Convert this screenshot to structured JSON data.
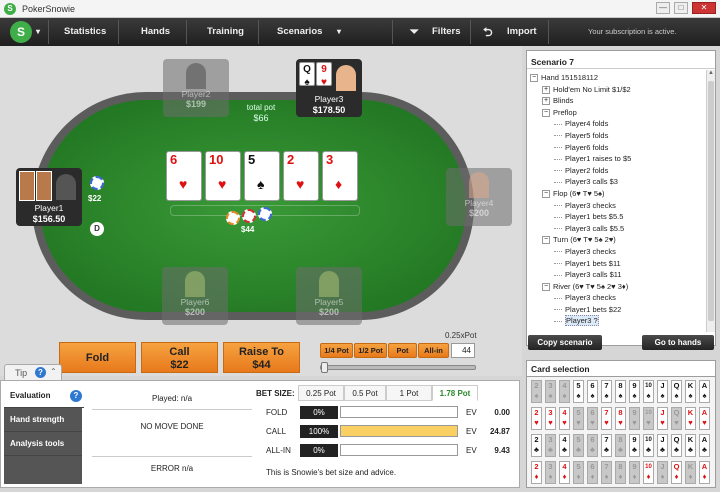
{
  "app": {
    "title": "PokerSnowie"
  },
  "window": {
    "minimize": "—",
    "maximize": "□",
    "close": "✕"
  },
  "menu": {
    "logo": "S",
    "items": [
      "Statistics",
      "Hands",
      "Training",
      "Scenarios"
    ],
    "filters": "Filters",
    "import": "Import",
    "subscription": "Your subscription is active."
  },
  "table": {
    "total_pot_label": "total pot",
    "total_pot": "$66",
    "bet_amount": "$22",
    "pot_chips_amount": "$44",
    "dealer": "D",
    "board": [
      {
        "rank": "6",
        "suit": "♥",
        "color": "red"
      },
      {
        "rank": "10",
        "suit": "♥",
        "color": "red"
      },
      {
        "rank": "5",
        "suit": "♠",
        "color": "black"
      },
      {
        "rank": "2",
        "suit": "♥",
        "color": "red"
      },
      {
        "rank": "3",
        "suit": "♦",
        "color": "red"
      }
    ],
    "hero_cards": [
      {
        "rank": "Q",
        "suit": "♠",
        "color": "black"
      },
      {
        "rank": "9",
        "suit": "♥",
        "color": "red"
      }
    ],
    "seats": [
      {
        "name": "Player2",
        "stack": "$199"
      },
      {
        "name": "Player3",
        "stack": "$178.50"
      },
      {
        "name": "Player1",
        "stack": "$156.50"
      },
      {
        "name": "Player4",
        "stack": "$200"
      },
      {
        "name": "Player6",
        "stack": "$200"
      },
      {
        "name": "Player5",
        "stack": "$200"
      }
    ]
  },
  "actions": {
    "fold": "Fold",
    "call": "Call",
    "call_amount": "$22",
    "raise": "Raise To",
    "raise_amount": "$44",
    "pot_buttons": [
      "1/4 Pot",
      "1/2 Pot",
      "Pot",
      "All-in"
    ],
    "bet_input": "44",
    "slider_label": "0.25xPot"
  },
  "tip": {
    "label": "Tip",
    "icon": "?"
  },
  "left_nav": [
    "Evaluation",
    "Hand strength",
    "Analysis tools"
  ],
  "evaluation": {
    "played": "Played: n/a",
    "no_move": "NO MOVE DONE",
    "error": "ERROR n/a",
    "bet_size_label": "BET SIZE:",
    "bet_sizes": [
      "0.25 Pot",
      "0.5 Pot",
      "1 Pot",
      "1.78 Pot"
    ],
    "rows": [
      {
        "action": "FOLD",
        "pct_text": "0%",
        "pct": 0,
        "ev_label": "EV",
        "ev": "0.00"
      },
      {
        "action": "CALL",
        "pct_text": "100%",
        "pct": 100,
        "ev_label": "EV",
        "ev": "24.87"
      },
      {
        "action": "ALL-IN",
        "pct_text": "0%",
        "pct": 0,
        "ev_label": "EV",
        "ev": "9.43"
      }
    ],
    "advice": "This is Snowie's bet size and advice."
  },
  "scenario": {
    "title": "Scenario 7",
    "tree": [
      {
        "text": "Hand 151518112",
        "level": 0,
        "toggle": "−"
      },
      {
        "text": "Hold'em No Limit $1/$2",
        "level": 1,
        "toggle": "+"
      },
      {
        "text": "Blinds",
        "level": 1,
        "toggle": "+"
      },
      {
        "text": "Preflop",
        "level": 1,
        "toggle": "−"
      },
      {
        "text": "Player4 folds",
        "level": 2
      },
      {
        "text": "Player5 folds",
        "level": 2
      },
      {
        "text": "Player6 folds",
        "level": 2
      },
      {
        "text": "Player1 raises to $5",
        "level": 2
      },
      {
        "text": "Player2 folds",
        "level": 2
      },
      {
        "text": "Player3 calls $3",
        "level": 2
      },
      {
        "text": "Flop (6♥ T♥ 5♠)",
        "level": 1,
        "toggle": "−"
      },
      {
        "text": "Player3 checks",
        "level": 2
      },
      {
        "text": "Player1 bets $5.5",
        "level": 2
      },
      {
        "text": "Player3 calls $5.5",
        "level": 2
      },
      {
        "text": "Turn (6♥ T♥ 5♠ 2♥)",
        "level": 1,
        "toggle": "−"
      },
      {
        "text": "Player3 checks",
        "level": 2
      },
      {
        "text": "Player1 bets $11",
        "level": 2
      },
      {
        "text": "Player3 calls $11",
        "level": 2
      },
      {
        "text": "River (6♥ T♥ 5♠ 2♥ 3♦)",
        "level": 1,
        "toggle": "−"
      },
      {
        "text": "Player3 checks",
        "level": 2
      },
      {
        "text": "Player1 bets $22",
        "level": 2
      },
      {
        "text": "Player3 ?",
        "level": 2,
        "selected": true
      }
    ],
    "copy": "Copy scenario",
    "goto": "Go to hands"
  },
  "card_selection": {
    "title": "Card selection",
    "ranks": [
      "2",
      "3",
      "4",
      "5",
      "6",
      "7",
      "8",
      "9",
      "10",
      "J",
      "Q",
      "K",
      "A"
    ],
    "suits": [
      {
        "suit": "♠",
        "color": "black"
      },
      {
        "suit": "♥",
        "color": "red"
      },
      {
        "suit": "♣",
        "color": "black"
      },
      {
        "suit": "♦",
        "color": "red"
      }
    ],
    "disabled": [
      [
        0,
        0
      ],
      [
        0,
        1
      ],
      [
        0,
        2
      ],
      [
        1,
        3
      ],
      [
        1,
        4
      ],
      [
        1,
        7
      ],
      [
        1,
        8
      ],
      [
        1,
        10
      ],
      [
        2,
        1
      ],
      [
        2,
        3
      ],
      [
        2,
        4
      ],
      [
        2,
        6
      ],
      [
        3,
        1
      ],
      [
        3,
        3
      ],
      [
        3,
        4
      ],
      [
        3,
        5
      ],
      [
        3,
        6
      ],
      [
        3,
        7
      ],
      [
        3,
        9
      ],
      [
        3,
        11
      ]
    ]
  }
}
